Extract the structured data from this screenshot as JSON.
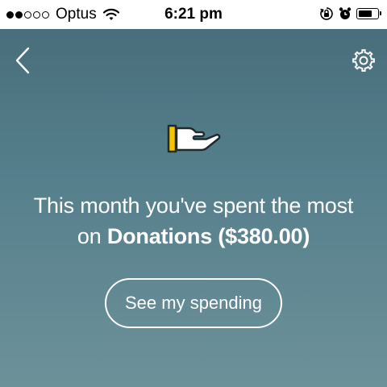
{
  "status_bar": {
    "signal_bars_filled": 2,
    "signal_bars_total": 5,
    "carrier": "Optus",
    "time": "6:21 pm",
    "battery_level": 0.75
  },
  "header": {
    "back_icon": "chevron-left-icon",
    "settings_icon": "gear-icon"
  },
  "hero": {
    "icon": "giving-hand-icon",
    "accent_color": "#f5c400"
  },
  "message": {
    "line1": "This month you've spent the most",
    "prefix": "on",
    "category": "Donations",
    "amount": "($380.00)"
  },
  "cta": {
    "label": "See my spending"
  }
}
